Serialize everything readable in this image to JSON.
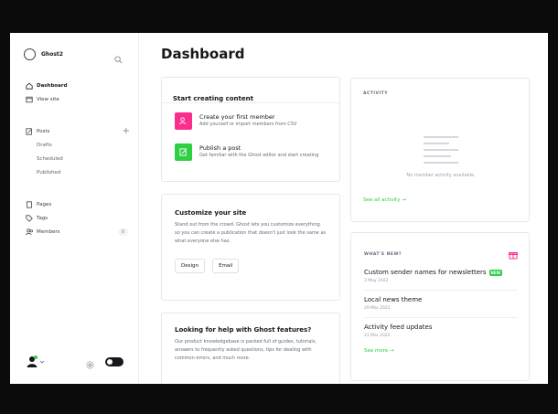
{
  "sidebar": {
    "site_name": "Ghost2",
    "nav": {
      "dashboard": "Dashboard",
      "view_site": "View site",
      "posts": "Posts",
      "drafts": "Drafts",
      "scheduled": "Scheduled",
      "published": "Published",
      "pages": "Pages",
      "tags": "Tags",
      "members": "Members",
      "members_count": "0"
    },
    "icons": {
      "search": "search-icon",
      "add_post": "plus-icon",
      "settings": "gear-icon",
      "theme_toggle": "toggle-icon"
    }
  },
  "main": {
    "title": "Dashboard",
    "start_card": {
      "title": "Start creating content",
      "task1_title": "Create your first member",
      "task1_desc": "Add yourself or import members from CSV",
      "task2_title": "Publish a post",
      "task2_desc": "Get familiar with the Ghost editor and start creating"
    },
    "customize_card": {
      "title": "Customize your site",
      "desc": "Stand out from the crowd. Ghost lets you customize everything so you can create a publication that doesn't just look the same as what everyone else has.",
      "design_btn": "Design",
      "email_btn": "Email"
    },
    "help_card": {
      "title": "Looking for help with Ghost features?",
      "desc": "Our product knowledgebase is packed full of guides, tutorials, answers to frequently asked questions, tips for dealing with common errors, and much more."
    },
    "activity_card": {
      "label": "ACTIVITY",
      "empty_text": "No member activity available.",
      "link": "See all activity →"
    },
    "news_card": {
      "label": "WHAT'S NEW?",
      "items": [
        {
          "title": "Custom sender names for newsletters",
          "badge": "NEW",
          "date": "3 May 2022"
        },
        {
          "title": "Local news theme",
          "date": "29 Mar 2022"
        },
        {
          "title": "Activity feed updates",
          "date": "21 Mar 2022"
        }
      ],
      "more_link": "See more →"
    }
  },
  "colors": {
    "accent_green": "#30cf43",
    "member_pink": "#fb2d8d",
    "dark": "#15171a"
  }
}
